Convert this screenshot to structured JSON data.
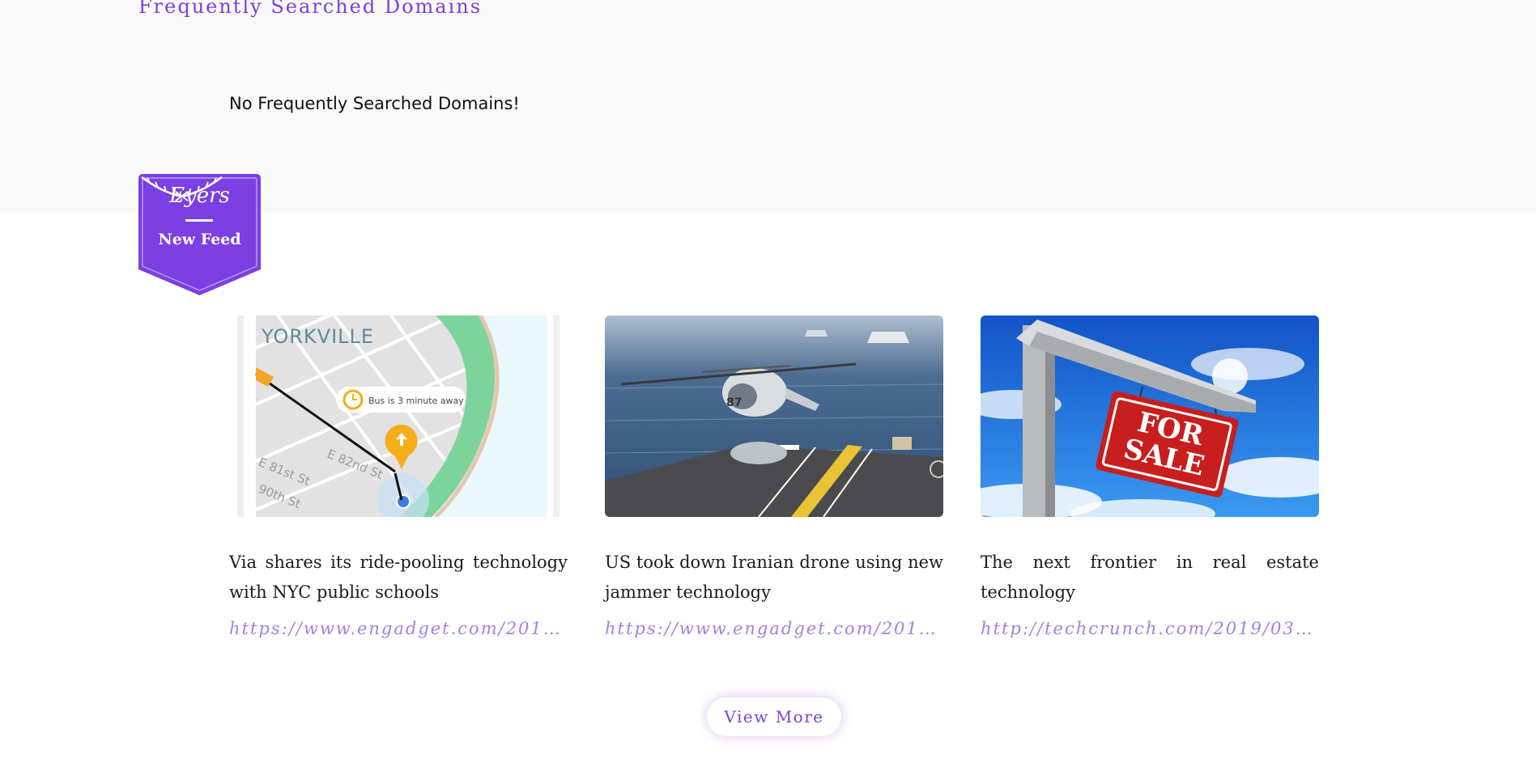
{
  "section": {
    "title": "Frequently Searched Domains",
    "empty_message": "No Frequently Searched Domains!"
  },
  "badge": {
    "brand": "Eyers",
    "label": "New Feed",
    "color": "#7b3fe4"
  },
  "feed": {
    "items": [
      {
        "title": "Via shares its ride-pooling technology with NYC public schools",
        "link": "https://www.engadget.com/2019/…",
        "image": {
          "neighborhood": "YORKVILLE",
          "bubble": "Bus is 3 minute away",
          "streets": [
            "E 81st St",
            "E 82nd St",
            "90th St"
          ]
        }
      },
      {
        "title": "US took down Iranian drone using new jammer technology",
        "link": "https://www.engadget.com/2019/…",
        "image": {
          "number": "87"
        }
      },
      {
        "title": "The next frontier in real estate technology",
        "link": "http://techcrunch.com/2019/03/1…",
        "image": {
          "sign_line1": "FOR",
          "sign_line2": "SALE"
        }
      }
    ]
  },
  "view_more_label": "View More"
}
